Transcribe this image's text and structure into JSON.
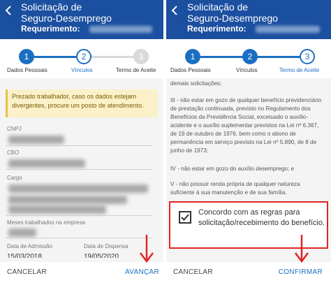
{
  "left": {
    "header": {
      "title_line1": "Solicitação de",
      "title_line2": "Seguro-Desemprego",
      "sub_label": "Requerimento:"
    },
    "steps": [
      {
        "number": "1",
        "label": "Dados Pessoais",
        "state": "done"
      },
      {
        "number": "2",
        "label": "Vínculos",
        "state": "current"
      },
      {
        "number": "3",
        "label": "Termo de Aceite",
        "state": "todo"
      }
    ],
    "warning": "Prezado trabalhador, caso os dados estejam divergentes, procure um posto de atendimento.",
    "fields": {
      "cnpj_label": "CNPJ",
      "cbo_label": "CBO",
      "cargo_label": "Cargo",
      "meses_label": "Meses trabalhados na empresa",
      "admissao_label": "Data de Admissão",
      "admissao_value": "15/03/2018",
      "dispensa_label": "Data de Dispensa",
      "dispensa_value": "19/05/2020"
    },
    "footer": {
      "cancel": "CANCELAR",
      "next": "AVANÇAR"
    }
  },
  "right": {
    "header": {
      "title_line1": "Solicitação de",
      "title_line2": "Seguro-Desemprego",
      "sub_label": "Requerimento:"
    },
    "steps": [
      {
        "number": "1",
        "label": "Dados Pessoais",
        "state": "done"
      },
      {
        "number": "2",
        "label": "Vínculos",
        "state": "done"
      },
      {
        "number": "3",
        "label": "Termo de Aceite",
        "state": "current"
      }
    ],
    "terms": {
      "top_line": "demais solicitações;",
      "item_iii": "III - não estar em gozo de qualquer benefício previdenciário de prestação continuada, previsto no Regulamento dos Benefícios da Previdência Social, excetuado o auxílio-acidente e o auxílio suplementar previstos na Lei nº 6.367, de 19 de outubro de 1976, bem como o abono de permanência em serviço previsto na Lei nº 5.890, de 8 de junho de 1973;",
      "item_iv": "IV - não estar em gozo do auxílio desemprego; e",
      "item_v": "V - não possuir renda própria de qualquer natureza suficiente à sua manutenção e de sua família."
    },
    "consent": "Concordo com as regras para solicitação/recebimento do benefício.",
    "footer": {
      "cancel": "CANCELAR",
      "confirm": "CONFIRMAR"
    }
  },
  "colors": {
    "header_blue": "#1b4fa0",
    "accent_blue": "#1b6fc2",
    "highlight_red": "#e02525",
    "warning_bg": "#fbf1c9"
  }
}
